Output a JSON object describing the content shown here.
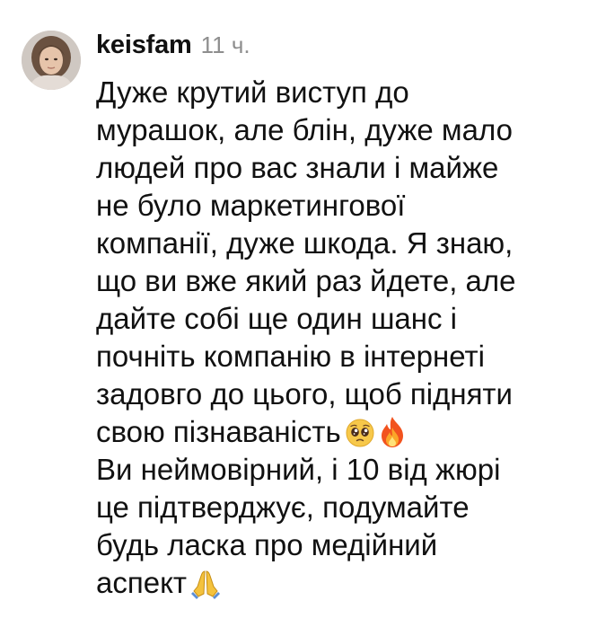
{
  "comment": {
    "username": "keisfam",
    "timestamp": "11 ч.",
    "avatar_icon": "user-avatar-photo",
    "paragraph1": {
      "lines": [
        "Дуже крутий виступ до",
        "мурашок, але блін, дуже мало",
        "людей про вас знали і майже",
        "не було маркетингової",
        "компанії, дуже шкода. Я знаю,",
        "що ви вже який раз йдете, але",
        "дайте собі ще один шанс і",
        "почніть компанію в інтернеті",
        "задовго до цього, щоб підняти",
        "свою пізнаваність"
      ],
      "trailing_emojis": [
        "pleading-face-emoji",
        "fire-emoji"
      ]
    },
    "paragraph2": {
      "lines": [
        "Ви неймовірний, і 10 від жюрі",
        "це підтверджує, подумайте",
        "будь ласка про медійний",
        "аспект"
      ],
      "trailing_emojis": [
        "folded-hands-emoji"
      ]
    }
  }
}
